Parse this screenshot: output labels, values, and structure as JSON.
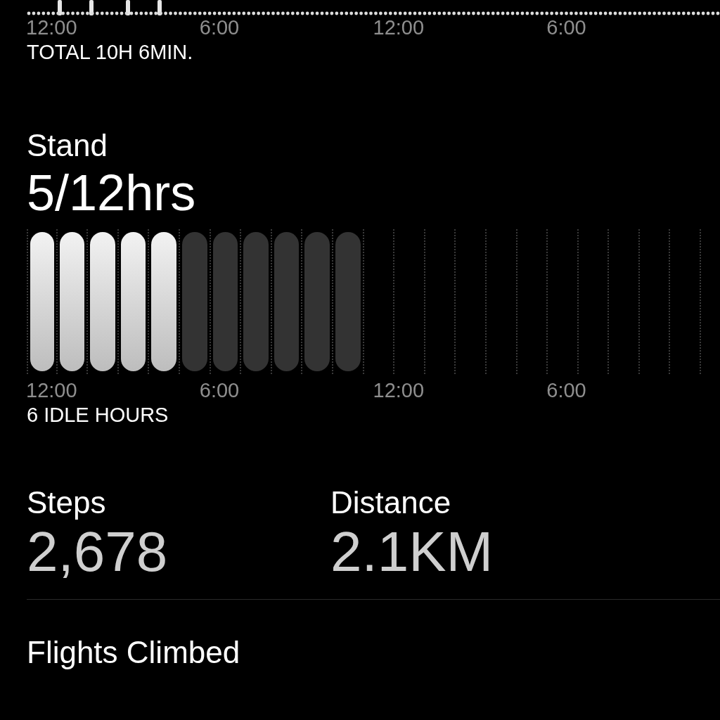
{
  "activity": {
    "axis_labels": [
      "12:00",
      "6:00",
      "12:00",
      "6:00"
    ],
    "total": "TOTAL 10H 6MIN."
  },
  "stand": {
    "title": "Stand",
    "value": "5/12hrs",
    "hours": [
      {
        "kind": "stood"
      },
      {
        "kind": "stood"
      },
      {
        "kind": "stood"
      },
      {
        "kind": "stood"
      },
      {
        "kind": "stood"
      },
      {
        "kind": "idle"
      },
      {
        "kind": "idle"
      },
      {
        "kind": "idle"
      },
      {
        "kind": "idle"
      },
      {
        "kind": "idle"
      },
      {
        "kind": "idle"
      },
      {
        "kind": "empty"
      },
      {
        "kind": "empty"
      },
      {
        "kind": "empty"
      },
      {
        "kind": "empty"
      },
      {
        "kind": "empty"
      },
      {
        "kind": "empty"
      },
      {
        "kind": "empty"
      },
      {
        "kind": "empty"
      },
      {
        "kind": "empty"
      },
      {
        "kind": "empty"
      },
      {
        "kind": "empty"
      }
    ],
    "axis_labels": [
      "12:00",
      "6:00",
      "12:00",
      "6:00"
    ],
    "summary": "6 IDLE HOURS"
  },
  "metrics": [
    {
      "label": "Steps",
      "value": "2,678"
    },
    {
      "label": "Distance",
      "value": "2.1KM"
    }
  ],
  "flights": {
    "label": "Flights Climbed"
  }
}
